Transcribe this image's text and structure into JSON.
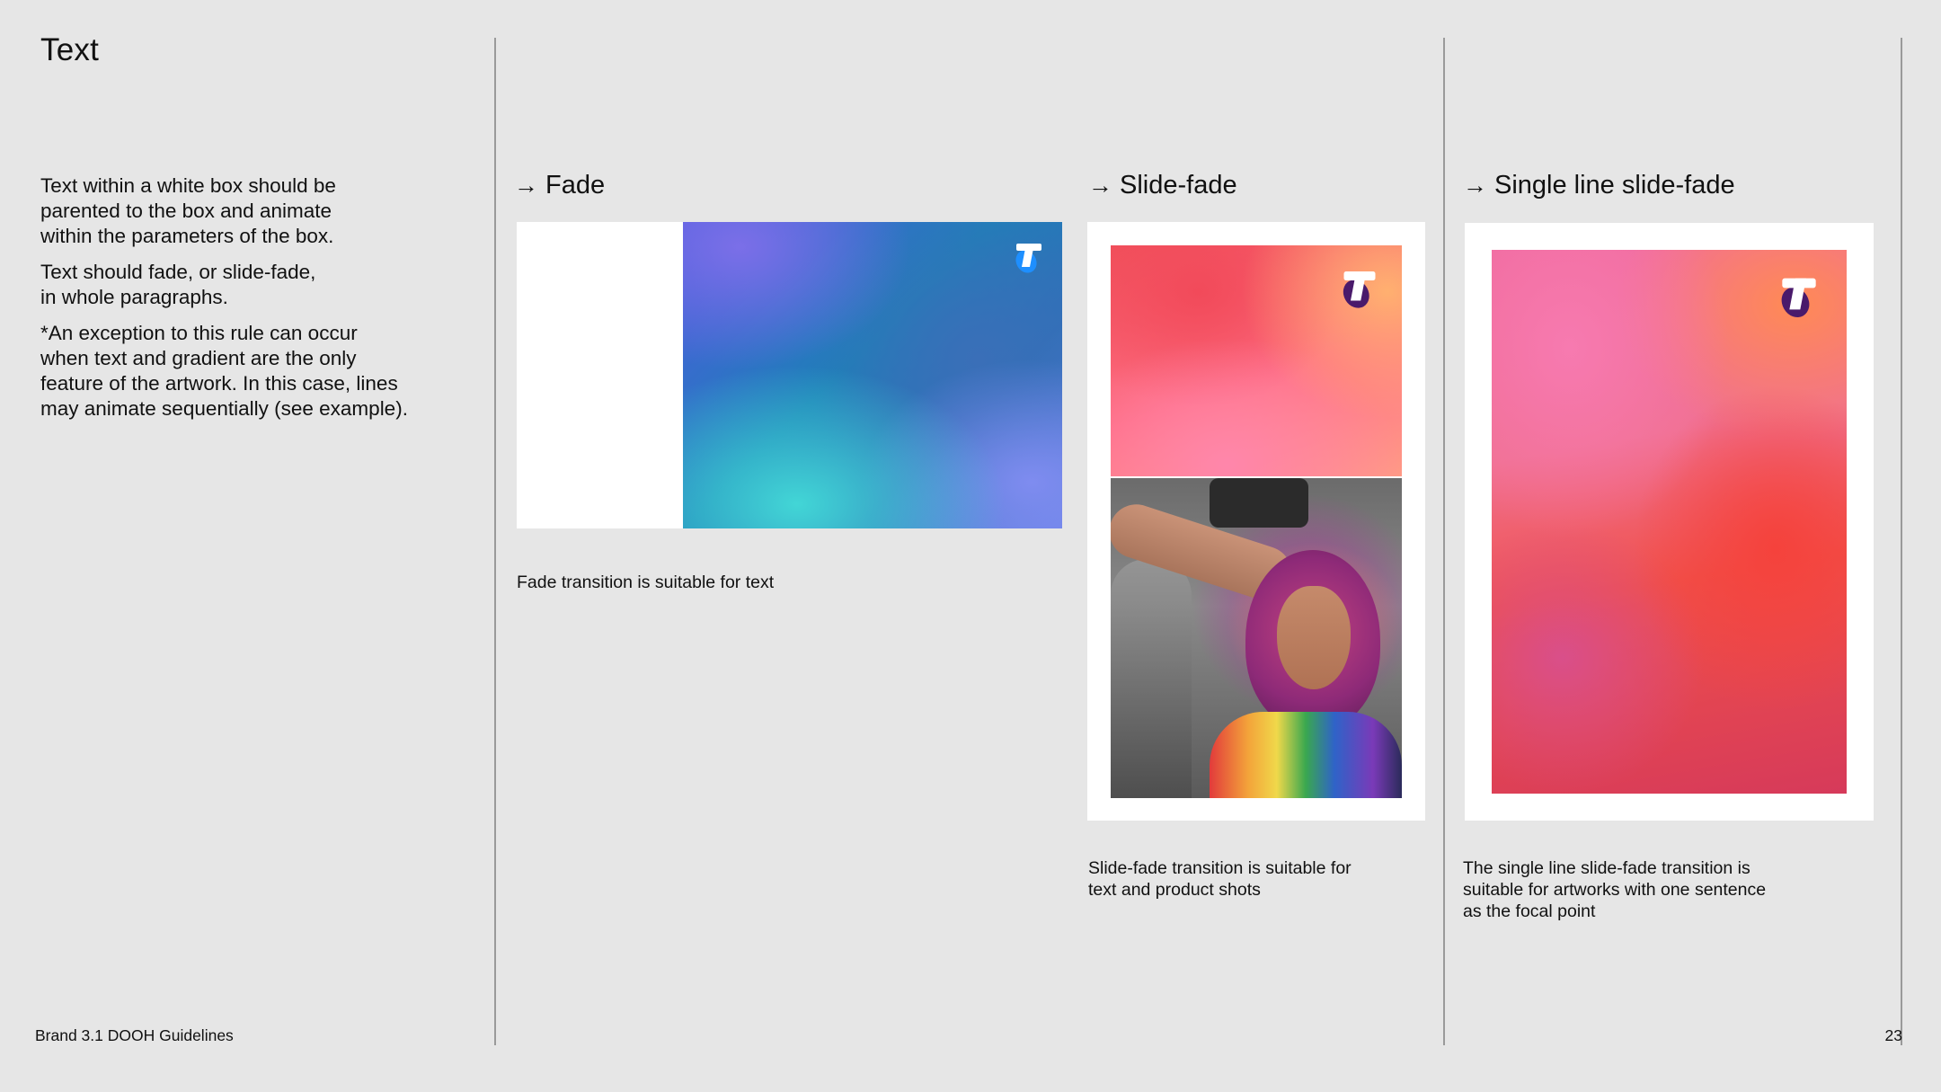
{
  "page": {
    "title": "Text",
    "intro": [
      "Text within a white box should be\nparented to the box and animate\nwithin the parameters of the box.",
      "Text should fade, or slide-fade,\nin whole paragraphs.",
      "*An exception to this rule can occur\nwhen text and gradient are the only\nfeature of the artwork. In this case, lines\nmay animate sequentially (see example)."
    ]
  },
  "panels": [
    {
      "arrow": "→",
      "heading": "Fade",
      "caption": "Fade transition is suitable for text"
    },
    {
      "arrow": "→",
      "heading": "Slide-fade",
      "caption": "Slide-fade transition is suitable for\ntext and product shots"
    },
    {
      "arrow": "→",
      "heading": "Single line slide-fade",
      "caption": "The single line slide-fade transition is\nsuitable for artworks with one sentence\nas the focal point"
    }
  ],
  "footer": {
    "left": "Brand 3.1 DOOH Guidelines",
    "page_number": "23"
  },
  "icons": {
    "logo": "telstra-t-logo-icon"
  },
  "colors": {
    "background": "#e6e6e6",
    "logo_blue": "#1e90ff",
    "logo_purple": "#4a1a6b"
  }
}
